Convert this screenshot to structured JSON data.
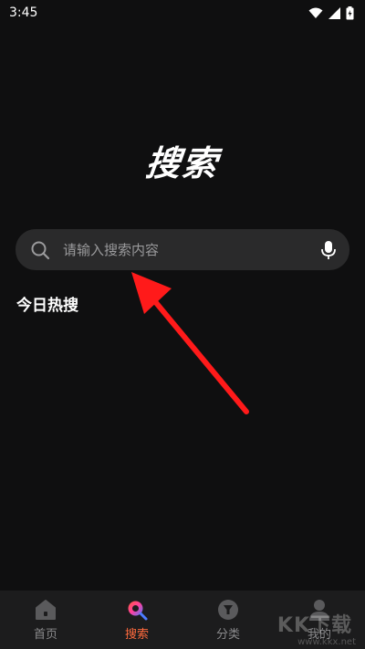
{
  "status_bar": {
    "time": "3:45",
    "icons": [
      "wifi-icon",
      "signal-icon",
      "battery-icon"
    ]
  },
  "page": {
    "title": "搜索"
  },
  "search": {
    "placeholder": "请输入搜索内容",
    "left_icon": "search-icon",
    "right_icon": "microphone-icon"
  },
  "hot_search": {
    "title": "今日热搜"
  },
  "bottom_nav": {
    "items": [
      {
        "label": "首页",
        "icon": "home-icon",
        "active": false
      },
      {
        "label": "搜索",
        "icon": "search-tab-icon",
        "active": true
      },
      {
        "label": "分类",
        "icon": "category-icon",
        "active": false
      },
      {
        "label": "我的",
        "icon": "profile-icon",
        "active": false
      }
    ]
  },
  "watermark": {
    "text": "KK下载",
    "url": "www.kkx.net"
  },
  "colors": {
    "background": "#0f0f10",
    "search_bar": "#2a2a2b",
    "accent": "#ff6a3d",
    "annotation_arrow": "#ff1a1a"
  }
}
